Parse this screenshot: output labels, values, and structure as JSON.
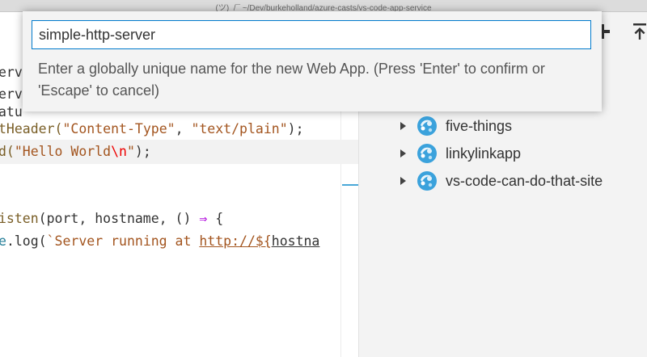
{
  "window": {
    "title": "(ツ)_/¯ ~/Dev/burkeholland/azure-casts/vs-code-app-service"
  },
  "quick_input": {
    "value": "simple-http-server",
    "message": "Enter a globally unique name for the new Web App. (Press 'Enter' to confirm or 'Escape' to cancel)"
  },
  "editor": {
    "partial_lines": [
      "erve",
      "erve",
      "atu"
    ],
    "line1": {
      "fn": "tHeader(",
      "s1": "\"Content-Type\"",
      "comma": ", ",
      "s2": "\"text/plain\"",
      "end": ");"
    },
    "line2": {
      "fn": "d(",
      "s1": "\"Hello World",
      "esc": "\\n",
      "s2": "\"",
      "end": ");"
    },
    "line3": {
      "fn": "isten",
      "args": "(port, hostname, () ",
      "arrow": "⇒",
      "end": " {"
    },
    "line4": {
      "obj": "e",
      "fn": ".log(",
      "tmpl": "`Server running at ",
      "url": "http://${",
      "rest": "hostna"
    }
  },
  "tree": {
    "items": [
      {
        "label": "five-things",
        "icon": "app-service-icon"
      },
      {
        "label": "linkylinkapp",
        "icon": "app-service-icon"
      },
      {
        "label": "vs-code-can-do-that-site",
        "icon": "app-service-icon"
      }
    ]
  },
  "toolbar": {
    "icons": [
      "plus-icon",
      "upload-icon"
    ]
  },
  "colors": {
    "focus": "#007acc",
    "string": "#a3551f",
    "keyword": "#af00db",
    "azure": "#3ba2dc"
  }
}
